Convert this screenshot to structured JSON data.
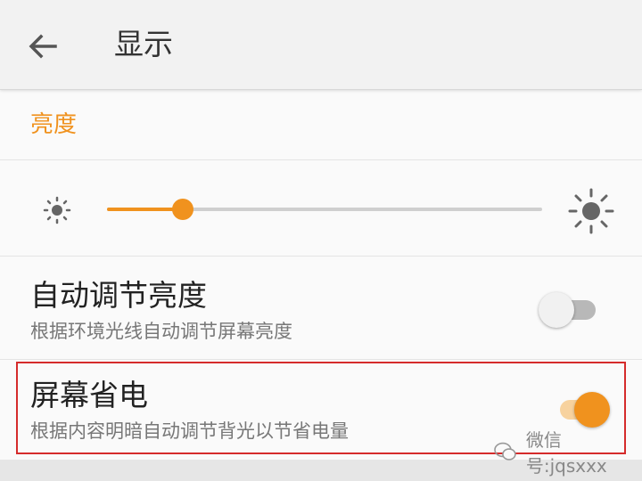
{
  "toolbar": {
    "title": "显示",
    "back_icon": "arrow-left-icon"
  },
  "brightness": {
    "section_title": "亮度",
    "slider_value": 0.175,
    "min_icon": "brightness-low-icon",
    "max_icon": "brightness-high-icon"
  },
  "auto_brightness": {
    "title": "自动调节亮度",
    "subtitle": "根据环境光线自动调节屏幕亮度",
    "enabled": false
  },
  "screen_saving": {
    "title": "屏幕省电",
    "subtitle": "根据内容明暗自动调节背光以节省电量",
    "enabled": true
  },
  "watermark": {
    "text": "微信号:jqsxxx"
  },
  "colors": {
    "accent": "#f0921e",
    "highlight_border": "#d52b2b",
    "toolbar_bg": "#f2f2f2",
    "background": "#fafafa"
  }
}
